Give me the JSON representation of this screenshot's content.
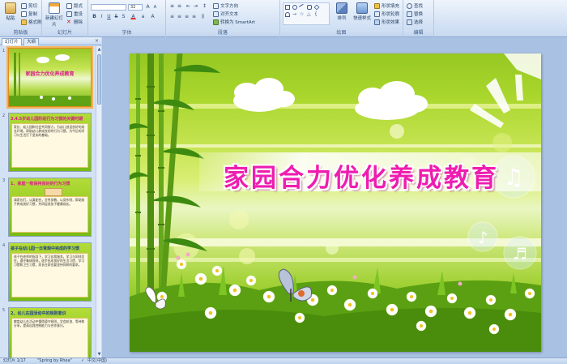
{
  "ribbon": {
    "clipboard": {
      "label": "剪贴板",
      "paste": "粘贴",
      "cut": "剪切",
      "copy": "复制",
      "format_painter": "格式刷"
    },
    "slides": {
      "label": "幻灯片",
      "new_slide": "新建幻灯片",
      "layout": "版式",
      "reset": "重设",
      "delete": "删除"
    },
    "font": {
      "label": "字体",
      "font_name": "",
      "font_size": "32"
    },
    "paragraph": {
      "label": "段落",
      "text_direction": "文字方向",
      "align_text": "对齐文本",
      "smartart": "转换为 SmartArt"
    },
    "drawing": {
      "label": "绘图",
      "arrange": "排列",
      "quick_styles": "快速样式",
      "shape_fill": "形状填充",
      "shape_outline": "形状轮廓",
      "shape_effects": "形状效果"
    },
    "editing": {
      "label": "编辑",
      "find": "查找",
      "replace": "替换",
      "select": "选择"
    }
  },
  "left_panel": {
    "tabs": [
      {
        "label": "幻灯片"
      },
      {
        "label": "大纲"
      }
    ],
    "close_glyph": "×",
    "thumbnails": [
      {
        "number": "1",
        "title": "家园合力优化养成教育",
        "body": ""
      },
      {
        "number": "2",
        "title": "3.4.5岁幼儿园阶段行为习惯的关键时期",
        "body": "家长、幼儿园和社会共同努力，为幼儿创设良好的成长环境，帮助幼儿养成良好的行为习惯，为今后的学习与生活打下坚实的基础。"
      },
      {
        "number": "3",
        "title": "1、家庭一致保持良好的行为习惯",
        "body": "请家长们，认真配合，言传身教，以身作则，帮助孩子养成良好习惯，共同促进孩子健康成长。"
      },
      {
        "number": "4",
        "title": "孩子在幼儿园一日常规中完成的学习惯",
        "body": "孩子在老师的指导下，学习自我服务，学习与同伴交往，遵守集体规则，逐步形成良好的生活习惯、学习习惯和卫生习惯，家长在家也要坚持同样的要求。"
      },
      {
        "number": "5",
        "title": "2、幼儿在园活动中的规则意识",
        "body": "教育幼儿在活动中懂得遵守规则，学会轮流、等待和分享，提高自我控制能力与合作意识。"
      }
    ]
  },
  "slide": {
    "title": "家园合力优化养成教育"
  },
  "status_bar": {
    "slide_info": "幻灯片 1/17",
    "theme": "\"Spring by Rhea\"",
    "language": "中文(中国)"
  },
  "colors": {
    "title_pink": "#ee1db0",
    "ribbon_blue": "#d6e4f5",
    "workspace": "#a9c1e2",
    "selection_orange": "#f2b35a"
  }
}
